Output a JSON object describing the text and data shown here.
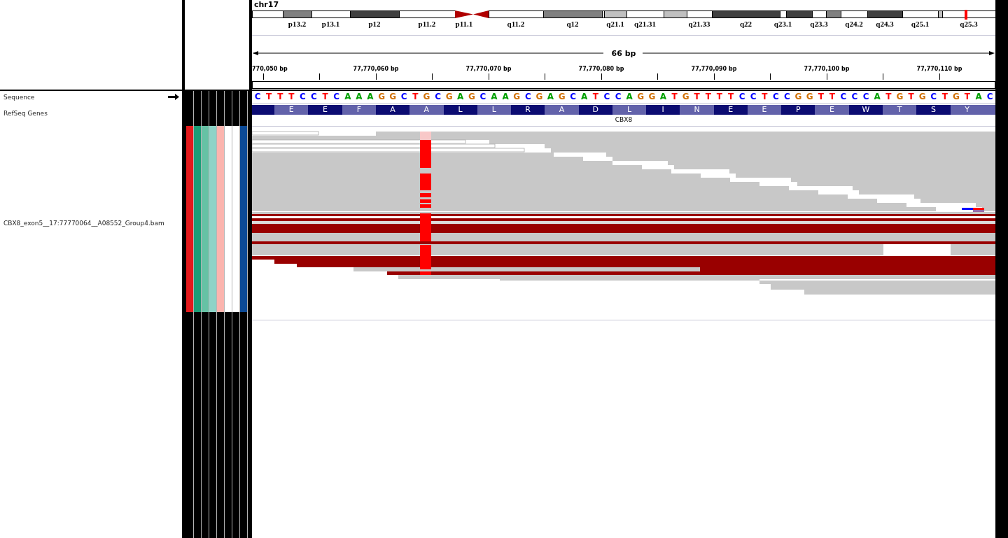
{
  "ideogram": {
    "chromosome": "chr17",
    "bands": [
      {
        "kind": "gneg"
      },
      {
        "kind": "gpos50",
        "label": "p13.2"
      },
      {
        "kind": "gneg",
        "label": "p13.1"
      },
      {
        "kind": "gpos75",
        "label": "p12"
      },
      {
        "kind": "gneg",
        "label": "p11.2"
      },
      {
        "kind": "acen",
        "label": "p11.1"
      },
      {
        "kind": "acen"
      },
      {
        "kind": "gneg",
        "label": "q11.2"
      },
      {
        "kind": "gpos50",
        "label": "q12"
      },
      {
        "kind": "gneg"
      },
      {
        "kind": "gpos25",
        "label": "q21.1"
      },
      {
        "kind": "gneg",
        "label": "q21.31"
      },
      {
        "kind": "gpos25"
      },
      {
        "kind": "gneg",
        "label": "q21.33"
      },
      {
        "kind": "gpos75",
        "label": "q22"
      },
      {
        "kind": "gneg",
        "label": "q23.1"
      },
      {
        "kind": "gpos75"
      },
      {
        "kind": "gneg",
        "label": "q23.3"
      },
      {
        "kind": "gpos50"
      },
      {
        "kind": "gneg",
        "label": "q24.2"
      },
      {
        "kind": "gpos75",
        "label": "q24.3"
      },
      {
        "kind": "gneg",
        "label": "q25.1"
      },
      {
        "kind": "gpos25"
      },
      {
        "kind": "gneg",
        "label": "q25.3"
      }
    ]
  },
  "ruler": {
    "span": "66 bp",
    "ticks": [
      "770,050 bp",
      "77,770,060 bp",
      "77,770,070 bp",
      "77,770,080 bp",
      "77,770,090 bp",
      "77,770,100 bp",
      "77,770,110 bp"
    ]
  },
  "tracks": [
    {
      "name": "Sequence"
    },
    {
      "name": "RefSeq Genes"
    },
    {
      "name": "CBX8_exon5__17:77770064__A08552_Group4.bam"
    }
  ],
  "attributes": [
    {
      "color": "#e41a1c"
    },
    {
      "color": "#1b9e77"
    },
    {
      "color": "#66c2a5"
    },
    {
      "color": "#8dd3c7"
    },
    {
      "color": "#fbb4ae"
    },
    {
      "color": "#ffffff"
    },
    {
      "color": "#ffffff"
    },
    {
      "color": "#0c4a96"
    }
  ],
  "sequence": [
    {
      "base": "C",
      "color": "#0000ff"
    },
    {
      "base": "T",
      "color": "#ff0000"
    },
    {
      "base": "T",
      "color": "#ff0000"
    },
    {
      "base": "T",
      "color": "#ff0000"
    },
    {
      "base": "C",
      "color": "#0000ff"
    },
    {
      "base": "C",
      "color": "#0000ff"
    },
    {
      "base": "T",
      "color": "#ff0000"
    },
    {
      "base": "C",
      "color": "#0000ff"
    },
    {
      "base": "A",
      "color": "#00a000"
    },
    {
      "base": "A",
      "color": "#00a000"
    },
    {
      "base": "A",
      "color": "#00a000"
    },
    {
      "base": "G",
      "color": "#d17105"
    },
    {
      "base": "G",
      "color": "#d17105"
    },
    {
      "base": "C",
      "color": "#0000ff"
    },
    {
      "base": "T",
      "color": "#ff0000"
    },
    {
      "base": "G",
      "color": "#d17105"
    },
    {
      "base": "C",
      "color": "#0000ff"
    },
    {
      "base": "G",
      "color": "#d17105"
    },
    {
      "base": "A",
      "color": "#00a000"
    },
    {
      "base": "G",
      "color": "#d17105"
    },
    {
      "base": "C",
      "color": "#0000ff"
    },
    {
      "base": "A",
      "color": "#00a000"
    },
    {
      "base": "A",
      "color": "#00a000"
    },
    {
      "base": "G",
      "color": "#d17105"
    },
    {
      "base": "C",
      "color": "#0000ff"
    },
    {
      "base": "G",
      "color": "#d17105"
    },
    {
      "base": "A",
      "color": "#00a000"
    },
    {
      "base": "G",
      "color": "#d17105"
    },
    {
      "base": "C",
      "color": "#0000ff"
    },
    {
      "base": "A",
      "color": "#00a000"
    },
    {
      "base": "T",
      "color": "#ff0000"
    },
    {
      "base": "C",
      "color": "#0000ff"
    },
    {
      "base": "C",
      "color": "#0000ff"
    },
    {
      "base": "A",
      "color": "#00a000"
    },
    {
      "base": "G",
      "color": "#d17105"
    },
    {
      "base": "G",
      "color": "#d17105"
    },
    {
      "base": "A",
      "color": "#00a000"
    },
    {
      "base": "T",
      "color": "#ff0000"
    },
    {
      "base": "G",
      "color": "#d17105"
    },
    {
      "base": "T",
      "color": "#ff0000"
    },
    {
      "base": "T",
      "color": "#ff0000"
    },
    {
      "base": "T",
      "color": "#ff0000"
    },
    {
      "base": "T",
      "color": "#ff0000"
    },
    {
      "base": "C",
      "color": "#0000ff"
    },
    {
      "base": "C",
      "color": "#0000ff"
    },
    {
      "base": "T",
      "color": "#ff0000"
    },
    {
      "base": "C",
      "color": "#0000ff"
    },
    {
      "base": "C",
      "color": "#0000ff"
    },
    {
      "base": "G",
      "color": "#d17105"
    },
    {
      "base": "G",
      "color": "#d17105"
    },
    {
      "base": "T",
      "color": "#ff0000"
    },
    {
      "base": "T",
      "color": "#ff0000"
    },
    {
      "base": "C",
      "color": "#0000ff"
    },
    {
      "base": "C",
      "color": "#0000ff"
    },
    {
      "base": "C",
      "color": "#0000ff"
    },
    {
      "base": "A",
      "color": "#00a000"
    },
    {
      "base": "T",
      "color": "#ff0000"
    },
    {
      "base": "G",
      "color": "#d17105"
    },
    {
      "base": "T",
      "color": "#ff0000"
    },
    {
      "base": "G",
      "color": "#d17105"
    },
    {
      "base": "C",
      "color": "#0000ff"
    },
    {
      "base": "T",
      "color": "#ff0000"
    },
    {
      "base": "G",
      "color": "#d17105"
    },
    {
      "base": "T",
      "color": "#ff0000"
    },
    {
      "base": "A",
      "color": "#00a000"
    },
    {
      "base": "C",
      "color": "#0000ff"
    }
  ],
  "translation": [
    "E",
    "E",
    "F",
    "A",
    "A",
    "L",
    "L",
    "R",
    "A",
    "D",
    "L",
    "I",
    "N",
    "E",
    "E",
    "P",
    "E",
    "W",
    "T",
    "S",
    "Y"
  ],
  "gene": {
    "name": "CBX8"
  }
}
